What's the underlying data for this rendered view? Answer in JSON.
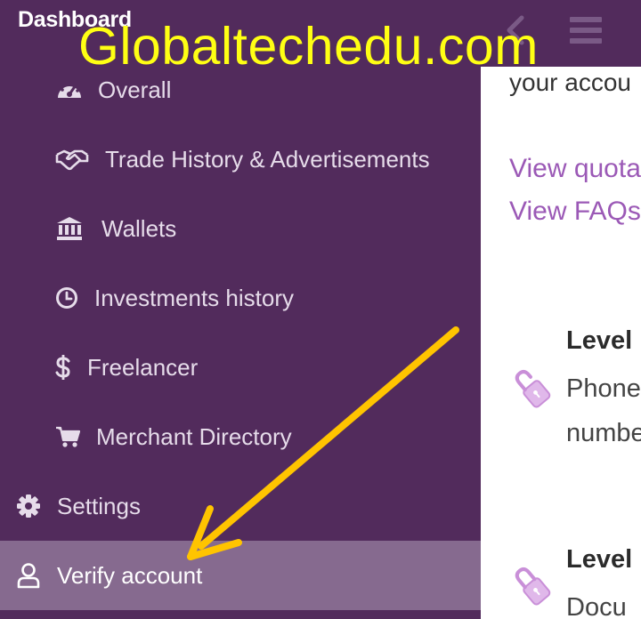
{
  "header": {
    "title": "Dashboard",
    "back_icon": "chevron-left-icon",
    "menu_icon": "hamburger-icon"
  },
  "watermark": {
    "text": "Globaltechedu.com",
    "color": "#ffff14"
  },
  "sidebar": {
    "background": "#522b5c",
    "active_background": "#866a8f",
    "items": [
      {
        "label": "Overall",
        "icon": "dashboard-gauge-icon"
      },
      {
        "label": "Trade History & Advertisements",
        "icon": "handshake-icon"
      },
      {
        "label": "Wallets",
        "icon": "bank-icon"
      },
      {
        "label": "Investments history",
        "icon": "clock-icon"
      },
      {
        "label": "Freelancer",
        "icon": "dollar-icon"
      },
      {
        "label": "Merchant Directory",
        "icon": "cart-icon"
      },
      {
        "label": "Settings",
        "icon": "gear-icon"
      },
      {
        "label": "Verify account",
        "icon": "user-icon",
        "active": true
      }
    ]
  },
  "content": {
    "intro_text": "your accou",
    "links": [
      {
        "label": "View quota"
      },
      {
        "label": "View FAQs"
      }
    ],
    "link_color": "#9b59b6",
    "levels": [
      {
        "title": "Level",
        "lines": [
          "Phone",
          "numbe"
        ],
        "icon": "unlocked-lock-icon"
      },
      {
        "title": "Level",
        "lines": [
          "Docu"
        ],
        "icon": "locked-icon"
      }
    ]
  },
  "annotation": {
    "arrow_color": "#ffc400",
    "arrow_icon": "arrow-pointer-icon"
  }
}
